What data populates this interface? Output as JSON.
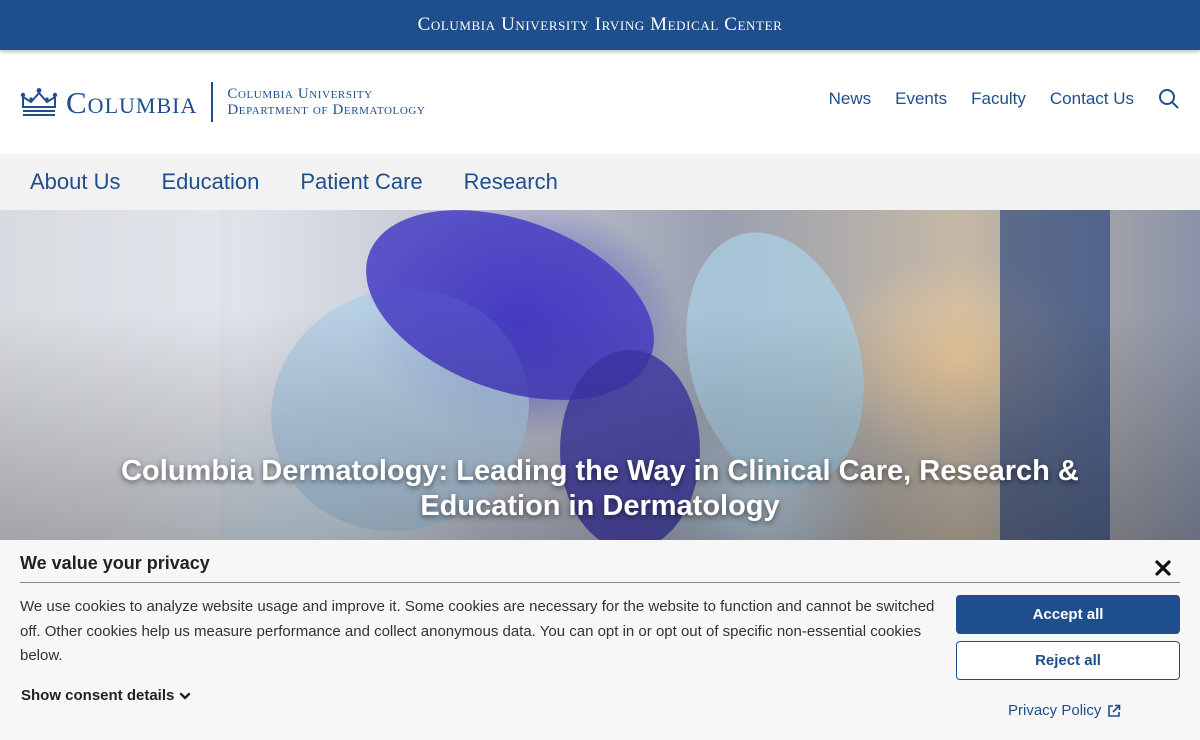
{
  "banner": {
    "text": "Columbia University Irving Medical Center"
  },
  "header": {
    "logo_word": "Columbia",
    "dept_line1": "Columbia University",
    "dept_line2": "Department of Dermatology",
    "logo_icon": "crown-icon",
    "util_nav": [
      "News",
      "Events",
      "Faculty",
      "Contact Us"
    ],
    "search_icon": "search-icon"
  },
  "main_nav": [
    "About Us",
    "Education",
    "Patient Care",
    "Research"
  ],
  "hero": {
    "title": "Columbia Dermatology: Leading the Way in Clinical Care, Research & Education in Dermatology"
  },
  "cookie": {
    "title": "We value your privacy",
    "text": "We use cookies to analyze website usage and improve it. Some cookies are necessary for the website to function and cannot be switched off. Other cookies help us measure performance and collect anonymous data. You can opt in or opt out of specific non-essential cookies below.",
    "show_details": "Show consent details",
    "accept": "Accept all",
    "reject": "Reject all",
    "privacy_policy": "Privacy Policy"
  },
  "colors": {
    "brand_blue": "#1f4e8c",
    "nav_bg": "#f2f2f2",
    "cookie_bg": "#f7f7f7"
  }
}
